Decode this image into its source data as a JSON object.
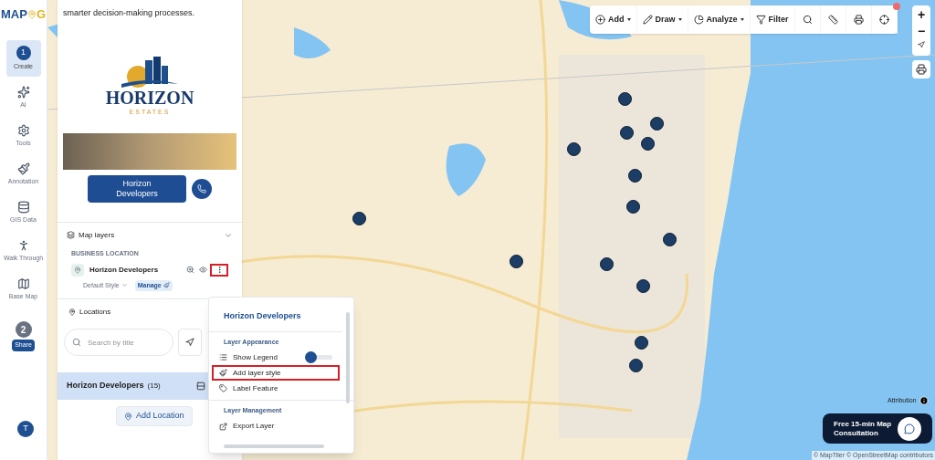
{
  "brand": {
    "text_start": "MAP",
    "text_end": "G"
  },
  "rail": {
    "steps": [
      {
        "number": "1",
        "label": "Create",
        "selected": true
      }
    ],
    "tools": [
      {
        "kind": "ai",
        "label": "AI"
      },
      {
        "kind": "tools",
        "label": "Tools"
      },
      {
        "kind": "annotation",
        "label": "Annotation"
      },
      {
        "kind": "gis",
        "label": "GIS Data"
      },
      {
        "kind": "walk",
        "label": "Walk Through"
      },
      {
        "kind": "basemap",
        "label": "Base Map"
      }
    ],
    "share": {
      "number": "2",
      "label": "Share",
      "selected": false
    },
    "avatar": "T"
  },
  "panel": {
    "description": "smarter decision-making processes.",
    "logo": {
      "name": "HORIZON",
      "tagline": "ESTATES"
    },
    "business_button": "Horizon Developers",
    "map_layers": {
      "title": "Map layers",
      "expanded": true,
      "group": "BUSINESS LOCATION",
      "layer": {
        "name": "Horizon Developers",
        "menu_highlighted": true,
        "style": "Default Style",
        "manage": "Manage"
      }
    },
    "locations": {
      "title": "Locations",
      "search_placeholder": "Search by title"
    },
    "list": [
      {
        "name": "Horizon Developers",
        "count": "(15)",
        "selected": true
      }
    ],
    "add_location": "Add Location"
  },
  "layer_menu": {
    "title": "Horizon Developers",
    "sections": [
      {
        "heading": "Layer Appearance",
        "items": [
          {
            "kind": "toggle",
            "label": "Show Legend",
            "on": false,
            "highlighted": false
          },
          {
            "kind": "action",
            "label": "Add layer style",
            "highlighted": true
          },
          {
            "kind": "action",
            "label": "Label Feature",
            "highlighted": false
          }
        ]
      },
      {
        "heading": "Layer Management",
        "items": [
          {
            "kind": "action",
            "label": "Export Layer",
            "highlighted": false
          }
        ]
      }
    ]
  },
  "toolbar": [
    {
      "kind": "dropdown",
      "label": "Add"
    },
    {
      "kind": "dropdown",
      "label": "Draw"
    },
    {
      "kind": "dropdown",
      "label": "Analyze"
    },
    {
      "kind": "button",
      "label": "Filter"
    }
  ],
  "zoom_controls": {
    "in": "+",
    "out": "−"
  },
  "attribution": "Attribution",
  "consultation": {
    "line1": "Free 15-min Map",
    "line2": "Consultation"
  },
  "credits": "© MapTiler © OpenStreetMap contributors"
}
